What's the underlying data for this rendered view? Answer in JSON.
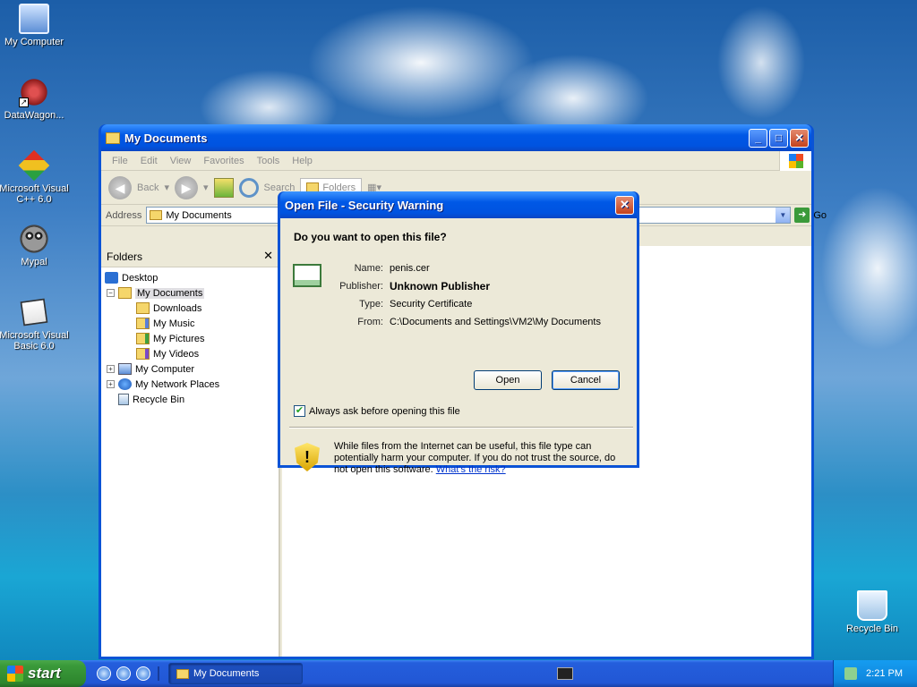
{
  "desktop": {
    "icons": [
      {
        "label": "My Computer"
      },
      {
        "label": "DataWagon..."
      },
      {
        "label": "Microsoft Visual C++ 6.0"
      },
      {
        "label": "Mypal"
      },
      {
        "label": "Microsoft Visual Basic 6.0"
      },
      {
        "label": "Recycle Bin"
      }
    ]
  },
  "explorer": {
    "title": "My Documents",
    "menu": [
      "File",
      "Edit",
      "View",
      "Favorites",
      "Tools",
      "Help"
    ],
    "toolbar": {
      "back": "Back",
      "search": "Search",
      "folders": "Folders"
    },
    "address": {
      "label": "Address",
      "value": "My Documents",
      "go": "Go"
    },
    "folders_pane": {
      "title": "Folders",
      "tree": [
        {
          "label": "Desktop"
        },
        {
          "label": "My Documents"
        },
        {
          "label": "Downloads"
        },
        {
          "label": "My Music"
        },
        {
          "label": "My Pictures"
        },
        {
          "label": "My Videos"
        },
        {
          "label": "My Computer"
        },
        {
          "label": "My Network Places"
        },
        {
          "label": "Recycle Bin"
        }
      ]
    }
  },
  "dialog": {
    "title": "Open File - Security Warning",
    "question": "Do you want to open this file?",
    "fields": [
      {
        "label": "Name:",
        "value": "penis.cer"
      },
      {
        "label": "Publisher:",
        "value": "Unknown Publisher"
      },
      {
        "label": "Type:",
        "value": "Security Certificate"
      },
      {
        "label": "From:",
        "value": "C:\\Documents and Settings\\VM2\\My Documents"
      }
    ],
    "buttons": {
      "open": "Open",
      "cancel": "Cancel"
    },
    "checkbox": {
      "label": "Always ask before opening this file",
      "checked": true
    },
    "warning": "While files from the Internet can be useful, this file type can potentially harm your computer. If you do not trust the source, do not open this software.",
    "link": "What's the risk?"
  },
  "taskbar": {
    "start": "start",
    "task": "My Documents",
    "clock": "2:21 PM"
  }
}
